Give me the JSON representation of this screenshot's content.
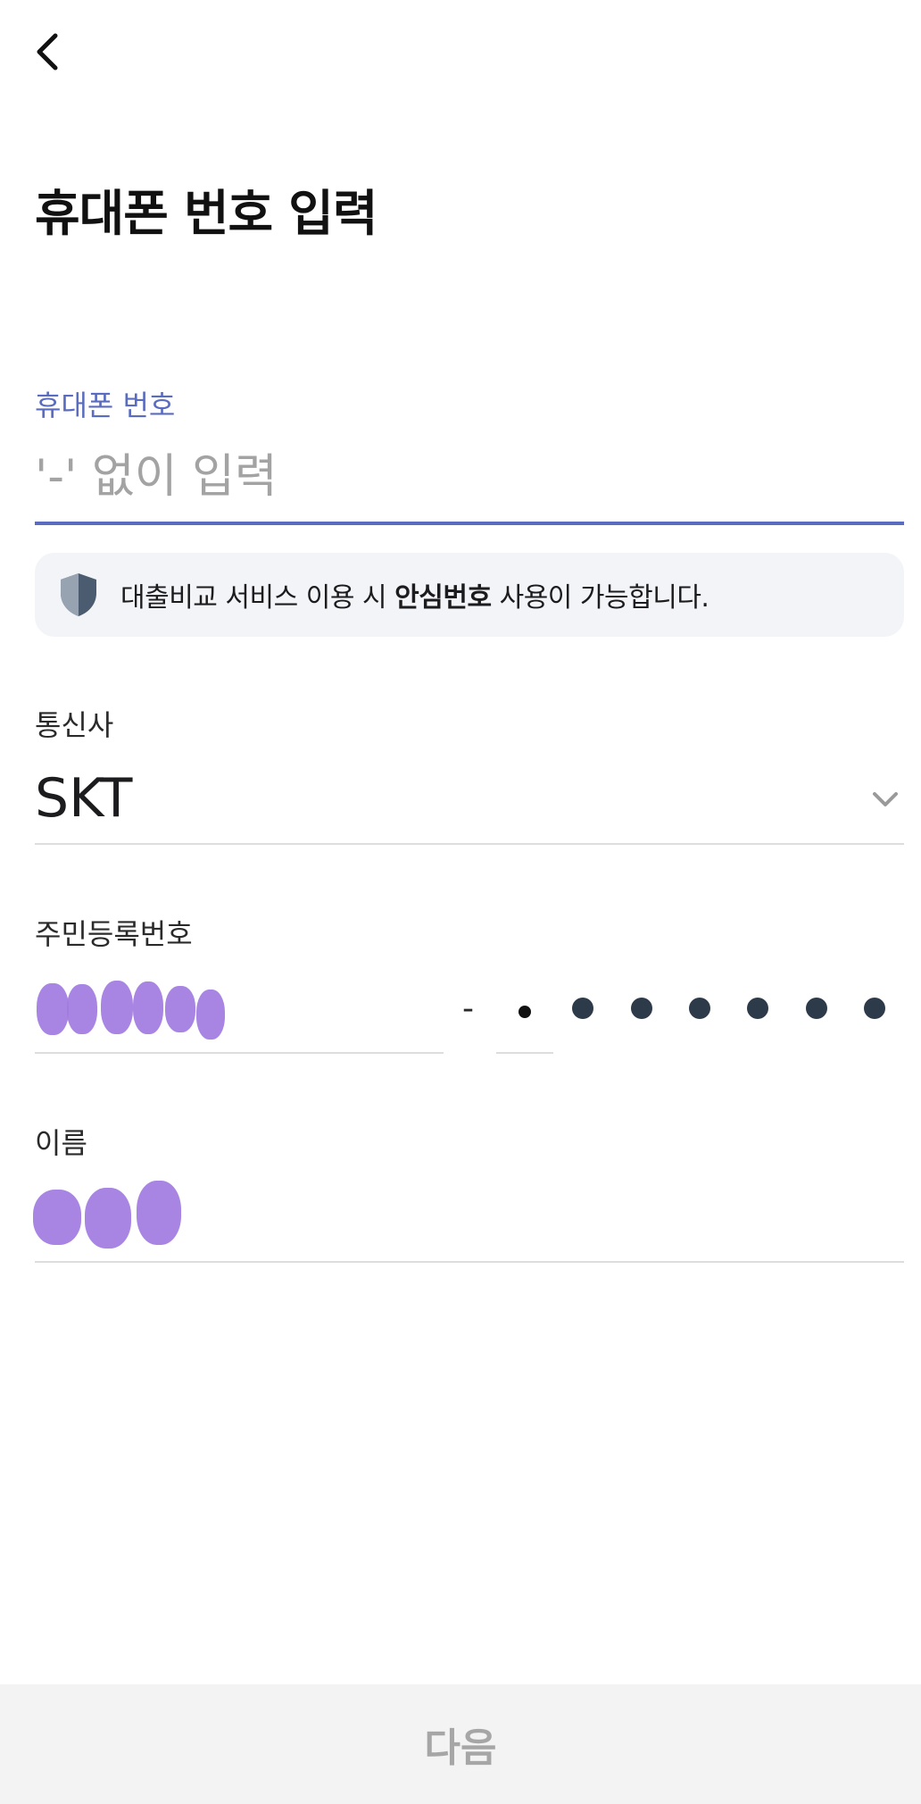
{
  "header": {
    "back_icon": "chevron-left-icon",
    "title": "휴대폰 번호 입력"
  },
  "phone": {
    "label": "휴대폰 번호",
    "placeholder": "'-' 없이 입력",
    "value": ""
  },
  "notice": {
    "icon": "shield-icon",
    "text_before": "대출비교 서비스 이용 시 ",
    "text_bold": "안심번호",
    "text_after": " 사용이 가능합니다."
  },
  "carrier": {
    "label": "통신사",
    "value": "SKT",
    "dropdown_icon": "chevron-down-icon"
  },
  "rrn": {
    "label": "주민등록번호",
    "separator": "-",
    "front_masked": true,
    "back_masked_digits": 6
  },
  "name": {
    "label": "이름",
    "masked": true
  },
  "footer": {
    "next_label": "다음"
  },
  "colors": {
    "accent": "#5a6cc0",
    "mask": "#a17be0",
    "dot": "#2d3a4a",
    "notice_bg": "#f3f4f7",
    "button_bg": "#f3f3f3",
    "button_text": "#a6a6a6"
  }
}
